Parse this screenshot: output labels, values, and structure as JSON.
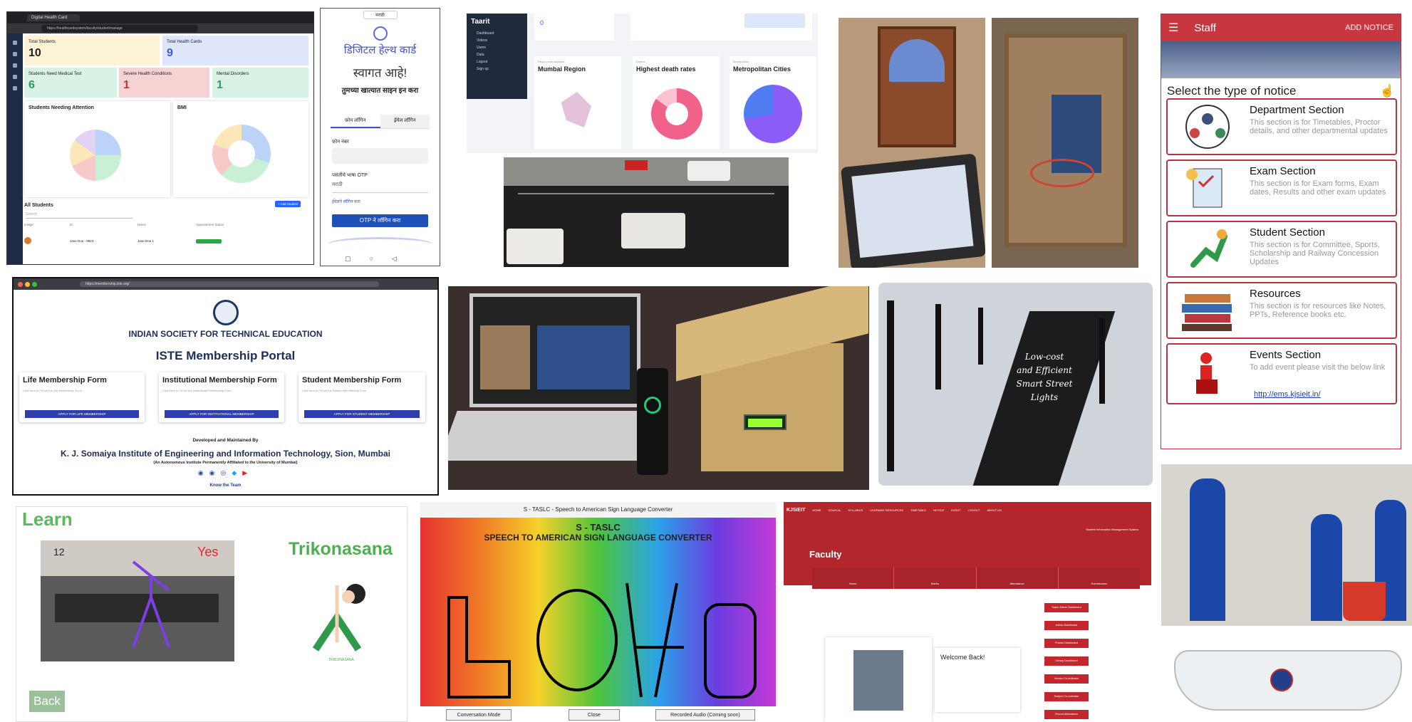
{
  "dashboard": {
    "tab_title": "Digital Health Card",
    "url": "https://healthcardsystem/faculty/studentmanage",
    "cards": [
      {
        "label": "Total Students",
        "value": "10"
      },
      {
        "label": "Total Health Cards",
        "value": "9"
      },
      {
        "label": "Students Need Medical Test",
        "value": "6"
      },
      {
        "label": "Severe Health Conditions",
        "value": "1"
      },
      {
        "label": "Mental Disorders",
        "value": "1"
      }
    ],
    "chart1_title": "Students Needing Attention",
    "chart2_title": "BMI",
    "table_title": "All Students",
    "add_button": "+ Add Student",
    "search_placeholder": "Search",
    "columns": [
      "Image",
      "ID",
      "Name",
      "Appointment Status"
    ],
    "row": {
      "id": "Jane Doe - 9823",
      "name": "Jane Doe 1"
    },
    "colors": {
      "card1": "#fdf3d6",
      "card2": "#dfe6fb",
      "card3": "#f7d2d3",
      "card4": "#d8f2e6",
      "sidebar": "#1f2a44"
    }
  },
  "phone": {
    "lang": "मराठी",
    "logo_text": "डिजिटल हेल्थ कार्ड",
    "welcome": "स्वागत आहे!",
    "subtitle": "तुमच्या खात्यात साइन इन करा",
    "tab1": "फ़ोन लॉगिन",
    "tab2": "ईमेल लॉगिन",
    "phone_label": "फ़ोन नंबर",
    "otp_label": "पसंतीचे भाषा OTP",
    "select": "मराठी",
    "link": "ईमेलने लॉगिन करा",
    "button": "OTP ने लॉगिन करा"
  },
  "analytics": {
    "brand": "Taarit",
    "menu": [
      "Dashboard",
      "Videos",
      "Users",
      "Data",
      "Logout",
      "Sign up"
    ],
    "top_value": "0",
    "charts": [
      {
        "kicker": "Region wise analysis",
        "title": "Mumbai Region"
      },
      {
        "kicker": "Deaths",
        "title": "Highest death rates"
      },
      {
        "kicker": "Metropolitan",
        "title": "Metropolitan Cities"
      }
    ]
  },
  "iste": {
    "url": "https://membership.iste.org/",
    "org": "INDIAN SOCIETY FOR TECHNICAL EDUCATION",
    "title": "ISTE Membership Portal",
    "cards": [
      {
        "title": "Life Membership Form",
        "desc": "Click here to Fill out the Life Membership Form",
        "button": "APPLY FOR LIFE MEMBERSHIP"
      },
      {
        "title": "Institutional Membership Form",
        "desc": "Click here to Fill out the Institutional Membership Form",
        "button": "APPLY FOR INSTITUTIONAL MEMBERSHIP"
      },
      {
        "title": "Student Membership Form",
        "desc": "Click here to Fill out the Student Membership Form",
        "button": "APPLY FOR STUDENT MEMBERSHIP"
      }
    ],
    "dev": "Developed and Maintained By",
    "institute": "K. J. Somaiya Institute of Engineering and Information Technology, Sion, Mumbai",
    "affiliation": "(An Autonomous Institute Permanently Affiliated to the University of Mumbai)",
    "team": "Know the Team"
  },
  "staff": {
    "title": "Staff",
    "add": "ADD NOTICE",
    "select": "Select the type of notice",
    "notices": [
      {
        "title": "Department Section",
        "desc": "This section is for Timetables, Proctor details, and other departmental updates"
      },
      {
        "title": "Exam Section",
        "desc": "This section is for Exam forms, Exam dates, Results and other exam updates"
      },
      {
        "title": "Student Section",
        "desc": "This section is for Committee, Sports, Scholarship and Railway Concession Updates"
      },
      {
        "title": "Resources",
        "desc": "This section is for resources like Notes, PPTs, Reference books etc."
      },
      {
        "title": "Events Section",
        "desc": "To add event please visit the below link"
      }
    ],
    "link": "http://ems.kjsieit.in/",
    "colors": {
      "header": "#c8373f"
    }
  },
  "street": {
    "caption1": "Low-cost",
    "caption2": "and Efficient",
    "caption3": "Smart Street",
    "caption4": "Lights"
  },
  "yoga": {
    "learn": "Learn",
    "counter": "12",
    "yes": "Yes",
    "pose": "Trikonasana",
    "back": "Back",
    "pose_caption": "TRIKONASANA"
  },
  "asl": {
    "window_title": "S - TASLC - Speech to American Sign Language Converter",
    "title1": "S - TASLC",
    "title2": "SPEECH TO AMERICAN SIGN LANGUAGE CONVERTER",
    "btn1": "Conversation Mode",
    "btn2": "Close",
    "btn3": "Recorded Audio (Coming soon)"
  },
  "kjsieit": {
    "brand": "KJSIEIT",
    "nav": [
      "HOME",
      "COUNCIL",
      "SYLLABUS",
      "LEARNING RESOURCES",
      "TIMETABLE",
      "NOTICE",
      "EVENT",
      "LOGOUT",
      "ABOUT US"
    ],
    "system": "Student Information Management System",
    "heading": "Faculty",
    "tabs": [
      "Home",
      "Marks",
      "Attendance",
      "Submissions"
    ],
    "welcome": "Welcome Back!",
    "buttons": [
      "Super Admin Dashboard",
      "Admin Dashboard",
      "Proctor Dashboard",
      "Library Dashboard",
      "Vendor Co-ordinator",
      "Subject Co-ordinator",
      "Record Attendance"
    ]
  }
}
